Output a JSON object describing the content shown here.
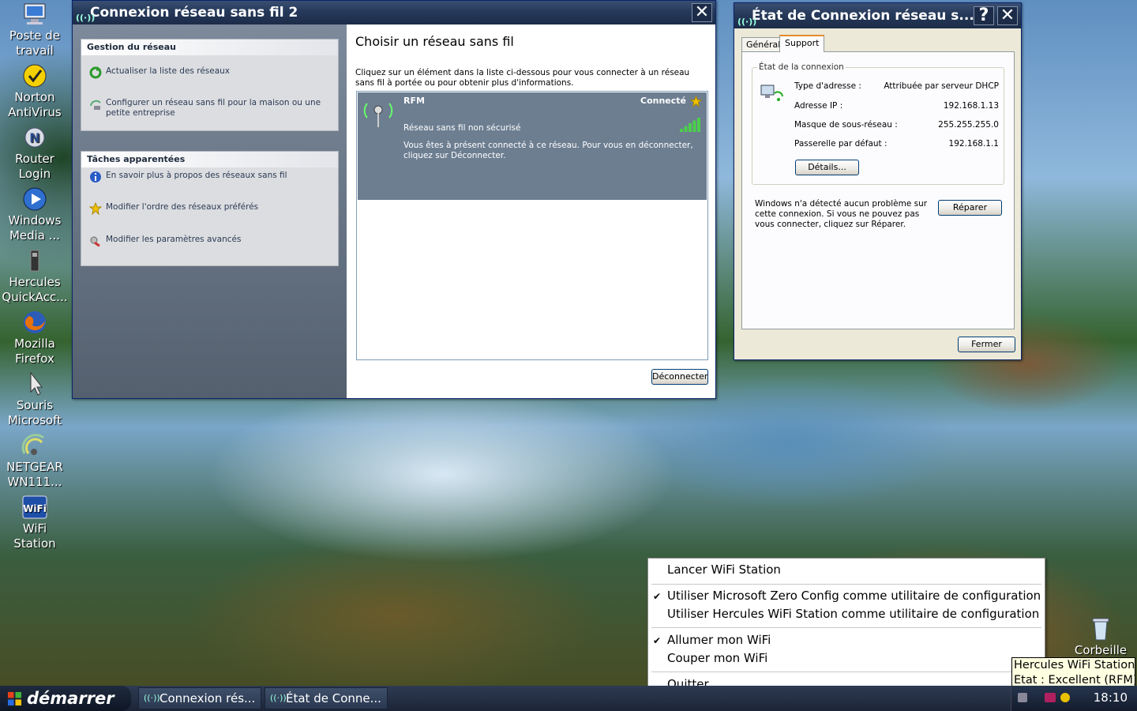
{
  "desktop_icons": [
    {
      "label": "Poste de travail",
      "icon": "computer-icon"
    },
    {
      "label": "Norton AntiVirus",
      "icon": "norton-icon"
    },
    {
      "label": "Router Login",
      "icon": "router-icon"
    },
    {
      "label": "Windows Media ...",
      "icon": "media-player-icon"
    },
    {
      "label": "Hercules QuickAcc...",
      "icon": "hercules-icon"
    },
    {
      "label": "Mozilla Firefox",
      "icon": "firefox-icon"
    },
    {
      "label": "Souris Microsoft",
      "icon": "mouse-icon"
    },
    {
      "label": "NETGEAR WN111...",
      "icon": "netgear-icon"
    },
    {
      "label": "WiFi Station",
      "icon": "wifi-station-icon"
    },
    {
      "label": "Corbeille",
      "icon": "recycle-bin-icon"
    }
  ],
  "wifi_window": {
    "title": "Connexion réseau sans fil 2",
    "sidebar": {
      "network_section": {
        "title": "Gestion du réseau",
        "items": [
          "Actualiser la liste des réseaux",
          "Configurer un réseau sans fil pour la maison ou une petite entreprise"
        ]
      },
      "related_section": {
        "title": "Tâches apparentées",
        "items": [
          "En savoir plus à propos des réseaux sans fil",
          "Modifier l'ordre des réseaux préférés",
          "Modifier les paramètres avancés"
        ]
      }
    },
    "main": {
      "heading": "Choisir un réseau sans fil",
      "description": "Cliquez sur un élément dans la liste ci-dessous pour vous connecter à un réseau sans fil à portée ou pour obtenir plus d'informations.",
      "network": {
        "name": "RFM",
        "status": "Connecté",
        "security": "Réseau sans fil non sécurisé",
        "message": "Vous êtes à présent connecté à ce réseau. Pour vous en déconnecter, cliquez sur Déconnecter.",
        "signal_bars": 5
      },
      "disconnect_label": "Déconnecter"
    }
  },
  "status_window": {
    "title": "État de Connexion réseau s...",
    "help_label": "?",
    "tabs": [
      "Général",
      "Support"
    ],
    "active_tab": "Support",
    "group_title": "État de la connexion",
    "rows": [
      {
        "label": "Type d'adresse :",
        "value": "Attribuée par serveur DHCP"
      },
      {
        "label": "Adresse IP :",
        "value": "192.168.1.13"
      },
      {
        "label": "Masque de sous-réseau :",
        "value": "255.255.255.0"
      },
      {
        "label": "Passerelle par défaut :",
        "value": "192.168.1.1"
      }
    ],
    "details_label": "Détails...",
    "repair_text": "Windows n'a détecté aucun problème sur cette connexion. Si vous ne pouvez pas vous connecter, cliquez sur Réparer.",
    "repair_label": "Réparer",
    "close_label": "Fermer"
  },
  "context_menu": {
    "items": [
      {
        "label": "Lancer WiFi Station",
        "checked": false
      },
      {
        "label": "Utiliser Microsoft Zero Config comme utilitaire de configuration",
        "checked": true
      },
      {
        "label": "Utiliser Hercules WiFi Station comme utilitaire de configuration",
        "checked": false
      },
      {
        "label": "Allumer mon WiFi",
        "checked": true
      },
      {
        "label": "Couper mon WiFi",
        "checked": false
      },
      {
        "label": "Quitter",
        "checked": false
      }
    ]
  },
  "tooltip": {
    "line1": "Hercules WiFi Station",
    "line2": "Etat : Excellent (RFM)"
  },
  "taskbar": {
    "start_label": "démarrer",
    "buttons": [
      "Connexion rés...",
      "État de Conne..."
    ],
    "clock": "18:10"
  }
}
